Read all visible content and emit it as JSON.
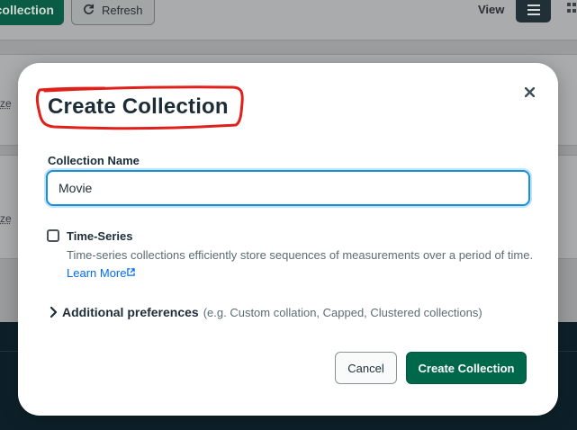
{
  "background": {
    "create_button_label": "collection",
    "refresh_button_label": "Refresh",
    "view_label": "View",
    "row_links": [
      "ze",
      "ze"
    ]
  },
  "modal": {
    "title": "Create Collection",
    "close_icon": "close-icon",
    "collection_name_label": "Collection Name",
    "collection_name_value": "Movie",
    "time_series": {
      "label": "Time-Series",
      "description": "Time-series collections efficiently store sequences of measurements over a period of time.",
      "learn_more_label": "Learn More",
      "checked": false
    },
    "additional_preferences": {
      "title": "Additional preferences",
      "hint": "(e.g. Custom collation, Capped, Clustered collections)"
    },
    "cancel_label": "Cancel",
    "create_label": "Create Collection"
  },
  "colors": {
    "primary_green": "#00684a",
    "focus_blue": "#1a8fd8",
    "link_blue": "#016bf8",
    "annotation_red": "#e0201b"
  }
}
